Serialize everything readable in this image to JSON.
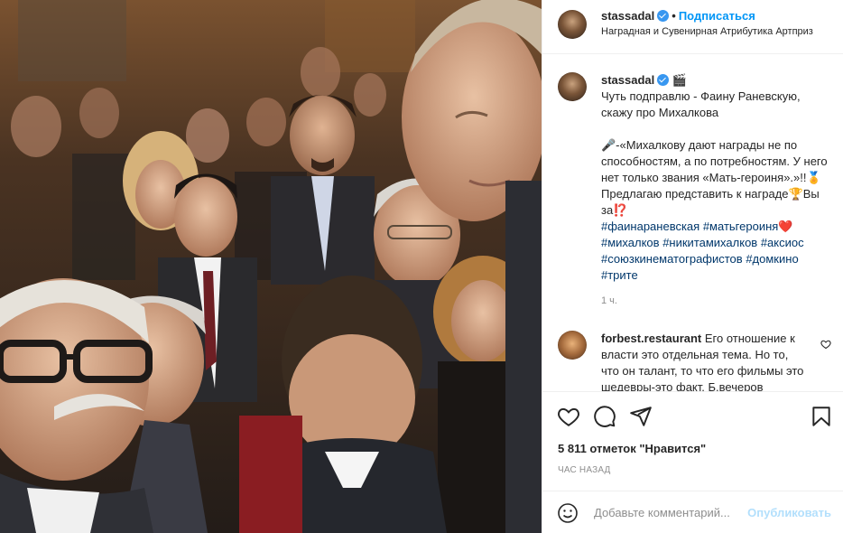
{
  "header": {
    "username": "stassadal",
    "dot": "•",
    "follow_label": "Подписаться",
    "subtitle": "Наградная и Сувенирная Атрибутика Артприз"
  },
  "caption": {
    "username": "stassadal",
    "emoji_after_name": "🎬",
    "line1": "Чуть подправлю - Фаину Раневскую, скажу про Михалкова",
    "line2": "🎤-«Михалкову дают награды не по способностям, а по потребностям. У него нет только звания «Мать-героиня».»!!🏅Предлагаю представить к награде🏆Вы за⁉️",
    "hashtags": [
      "#фаинараневская",
      "#матьгероиня❤️",
      "#михалков",
      "#никитамихалков",
      "#аксиос",
      "#союзкинематографистов",
      "#домкино",
      "#трите"
    ],
    "time": "1 ч."
  },
  "comment": {
    "username": "forbest.restaurant",
    "text": "Его отношение к власти это отдельная тема. Но то, что он талант, то что его фильмы это шедевры-это факт. Б.вечеров"
  },
  "actions": {
    "like_icon": "heart-icon",
    "comment_icon": "comment-icon",
    "share_icon": "share-icon",
    "save_icon": "bookmark-icon",
    "likes_text": "5 811 отметок \"Нравится\"",
    "ago_text": "ЧАС НАЗАД"
  },
  "add_comment": {
    "placeholder": "Добавьте комментарий...",
    "post_label": "Опубликовать"
  },
  "colors": {
    "accent": "#0095f6",
    "hashtag": "#00376b",
    "muted": "#8e8e8e",
    "post_disabled": "#b2dffc"
  }
}
